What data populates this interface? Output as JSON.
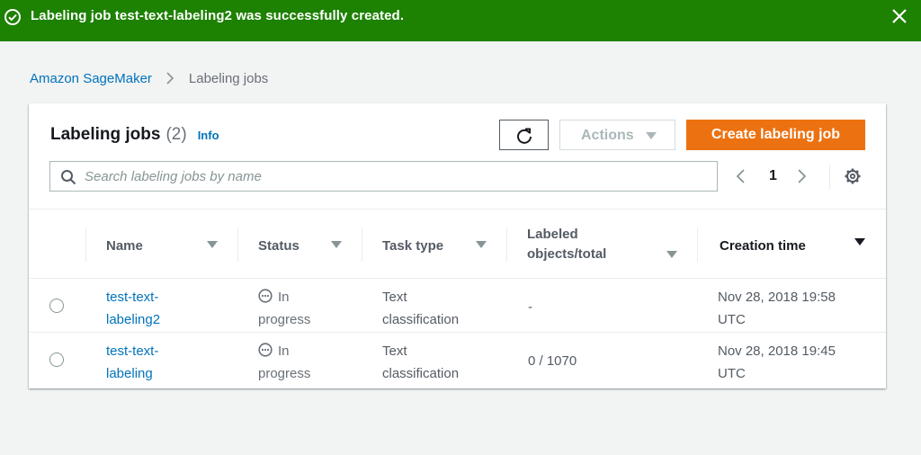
{
  "flash": {
    "message": "Labeling job test-text-labeling2 was successfully created.",
    "color": "#1d8102"
  },
  "breadcrumb": {
    "root": "Amazon SageMaker",
    "current": "Labeling jobs"
  },
  "panel": {
    "title": "Labeling jobs",
    "count": "(2)",
    "info": "Info",
    "actions_label": "Actions",
    "create_label": "Create labeling job",
    "create_color": "#ec7211"
  },
  "search": {
    "placeholder": "Search labeling jobs by name",
    "value": ""
  },
  "pager": {
    "page": "1"
  },
  "table": {
    "headers": {
      "name": "Name",
      "status": "Status",
      "task_type": "Task type",
      "labeled_line1": "Labeled",
      "labeled_line2": "objects/total",
      "creation_time": "Creation time"
    },
    "rows": [
      {
        "name_line1": "test-text-",
        "name_line2": "labeling2",
        "status_line1": "In",
        "status_line2": "progress",
        "task_line1": "Text",
        "task_line2": "classification",
        "labeled": "-",
        "time_line1": "Nov 28, 2018 19:58",
        "time_line2": "UTC"
      },
      {
        "name_line1": "test-text-",
        "name_line2": "labeling",
        "status_line1": "In",
        "status_line2": "progress",
        "task_line1": "Text",
        "task_line2": "classification",
        "labeled": "0 / 1070",
        "time_line1": "Nov 28, 2018 19:45",
        "time_line2": "UTC"
      }
    ]
  }
}
